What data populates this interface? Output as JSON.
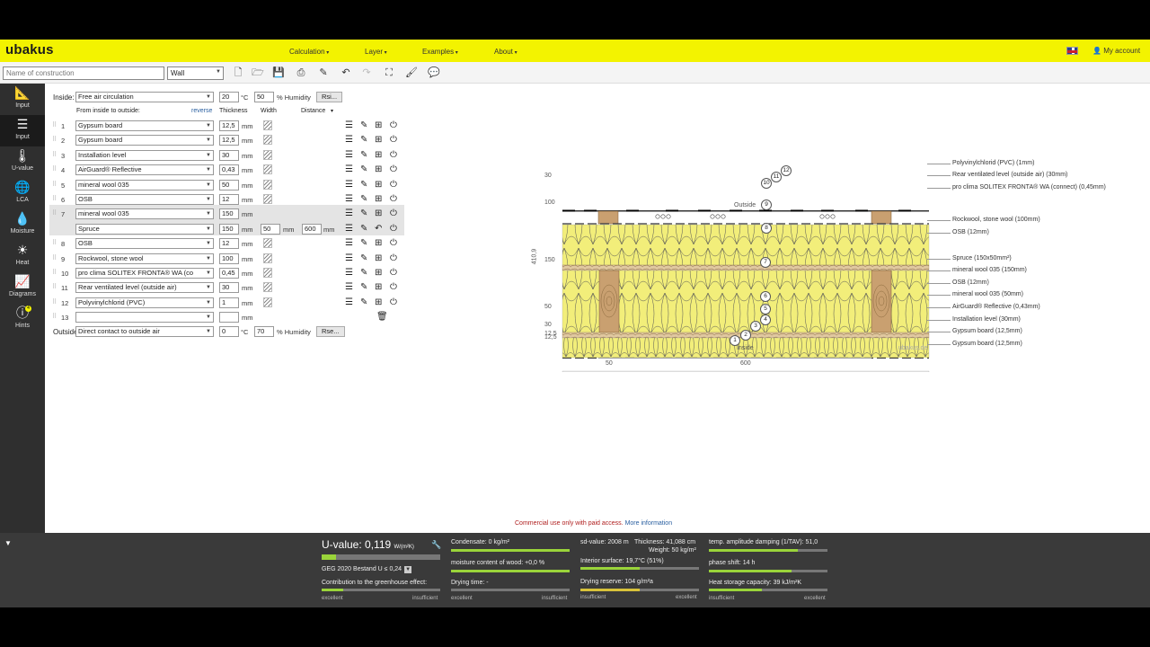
{
  "topbar": {
    "logo": "ubakus",
    "nav": [
      "Calculation",
      "Layer",
      "Examples",
      "About"
    ],
    "account": "My account"
  },
  "toolbar": {
    "name_placeholder": "Name of construction",
    "type_value": "Wall",
    "icons": [
      "new-file-icon",
      "open-folder-icon",
      "save-icon",
      "export-icon",
      "brush-icon",
      "undo-icon",
      "redo-icon",
      "fit-icon",
      "paint-icon",
      "comment-icon"
    ]
  },
  "sidebar": [
    {
      "label": "Input",
      "icon": "ruler-icon"
    },
    {
      "label": "Input",
      "icon": "layers-icon"
    },
    {
      "label": "U-value",
      "icon": "thermometer-icon"
    },
    {
      "label": "LCA",
      "icon": "globe-icon"
    },
    {
      "label": "Moisture",
      "icon": "drop-icon"
    },
    {
      "label": "Heat",
      "icon": "sun-icon"
    },
    {
      "label": "Diagrams",
      "icon": "chart-icon"
    },
    {
      "label": "Hints",
      "icon": "info-icon",
      "badge": "4"
    }
  ],
  "inside": {
    "label": "Inside:",
    "condition": "Free air circulation",
    "temp": "20",
    "temp_unit": "°C",
    "humidity": "50",
    "humidity_unit": "% Humidity",
    "rsi": "Rsi..."
  },
  "headers": {
    "from": "From inside to outside:",
    "reverse": "reverse",
    "thickness": "Thickness",
    "width": "Width",
    "distance": "Distance"
  },
  "layers": [
    {
      "n": "1",
      "material": "Gypsum board",
      "thickness": "12,5",
      "unit": "mm"
    },
    {
      "n": "2",
      "material": "Gypsum board",
      "thickness": "12,5",
      "unit": "mm"
    },
    {
      "n": "3",
      "material": "Installation level",
      "thickness": "30",
      "unit": "mm"
    },
    {
      "n": "4",
      "material": "AirGuard® Reflective",
      "thickness": "0,43",
      "unit": "mm"
    },
    {
      "n": "5",
      "material": "mineral wool 035",
      "thickness": "50",
      "unit": "mm"
    },
    {
      "n": "6",
      "material": "OSB",
      "thickness": "12",
      "unit": "mm"
    },
    {
      "n": "7",
      "material": "mineral wool 035",
      "thickness": "150",
      "unit": "mm"
    },
    {
      "n": "",
      "material": "Spruce",
      "thickness": "150",
      "unit": "mm",
      "width": "50",
      "width_unit": "mm",
      "distance": "600",
      "distance_unit": "mm"
    },
    {
      "n": "8",
      "material": "OSB",
      "thickness": "12",
      "unit": "mm"
    },
    {
      "n": "9",
      "material": "Rockwool, stone wool",
      "thickness": "100",
      "unit": "mm"
    },
    {
      "n": "10",
      "material": "pro clima SOLITEX FRONTA® WA (co",
      "thickness": "0,45",
      "unit": "mm"
    },
    {
      "n": "11",
      "material": "Rear ventilated level (outside air)",
      "thickness": "30",
      "unit": "mm"
    },
    {
      "n": "12",
      "material": "Polyvinylchlorid (PVC)",
      "thickness": "1",
      "unit": "mm"
    },
    {
      "n": "13",
      "material": "",
      "thickness": "",
      "unit": "mm"
    }
  ],
  "outside": {
    "label": "Outside",
    "condition": "Direct contact to outside air",
    "temp": "0",
    "temp_unit": "°C",
    "humidity": "70",
    "humidity_unit": "% Humidity",
    "rse": "Rse..."
  },
  "drawing": {
    "outside_label": "Outside",
    "inside_label": "Inside",
    "watermark": "ubakus.de",
    "total_dim": "410,9",
    "left_dims": [
      "30",
      "100",
      "150",
      "50",
      "30",
      "12,5",
      "12,5"
    ],
    "bottom_dims": [
      "50",
      "600"
    ],
    "legend": [
      "Polyvinylchlorid (PVC) (1mm)",
      "Rear ventilated level (outside air) (30mm)",
      "pro clima SOLITEX FRONTA® WA (connect) (0,45mm)",
      "Rockwool, stone wool (100mm)",
      "OSB (12mm)",
      "Spruce (150x50mm²)",
      "mineral wool 035 (150mm)",
      "OSB (12mm)",
      "mineral wool 035 (50mm)",
      "AirGuard® Reflective (0,43mm)",
      "Installation level (30mm)",
      "Gypsum board (12,5mm)",
      "Gypsum board (12,5mm)"
    ],
    "markers": [
      "12",
      "11",
      "10",
      "9",
      "8",
      "7",
      "6",
      "5",
      "4",
      "3",
      "2",
      "1"
    ]
  },
  "commercial": {
    "text": "Commercial use only with paid access.",
    "link": "More information"
  },
  "bottom": {
    "uvalue_label": "U-value:",
    "uvalue": "0,119",
    "uvalue_unit": "W/(m²K)",
    "uvalue_level": 0.12,
    "geg": "GEG 2020 Bestand U ≤ 0,24",
    "greenhouse": "Contribution to the greenhouse effect:",
    "greenhouse_level": 0.18,
    "condensate": "Condensate: 0 kg/m²",
    "moisture": "moisture content of wood: +0,0 %",
    "drying_time": "Drying time: -",
    "sd_value": "sd-value: 2008 m",
    "thickness": "Thickness: 41,088 cm",
    "weight": "Weight: 50 kg/m²",
    "interior_surface": "Interior surface: 19,7°C (51%)",
    "interior_surface_level": 0.5,
    "drying_reserve": "Drying reserve: 104 g/m²a",
    "drying_reserve_level": 0.5,
    "temp_damping": "temp. amplitude damping (1/TAV): 51,0",
    "temp_damping_level": 0.75,
    "phase_shift": "phase shift: 14 h",
    "phase_shift_level": 0.7,
    "heat_storage": "Heat storage capacity: 39 kJ/m²K",
    "heat_storage_level": 0.45,
    "excellent": "excellent",
    "insufficient": "insufficient",
    "colors": {
      "good": "#9ad43a",
      "mid": "#d8c23a",
      "track": "#777777"
    }
  }
}
